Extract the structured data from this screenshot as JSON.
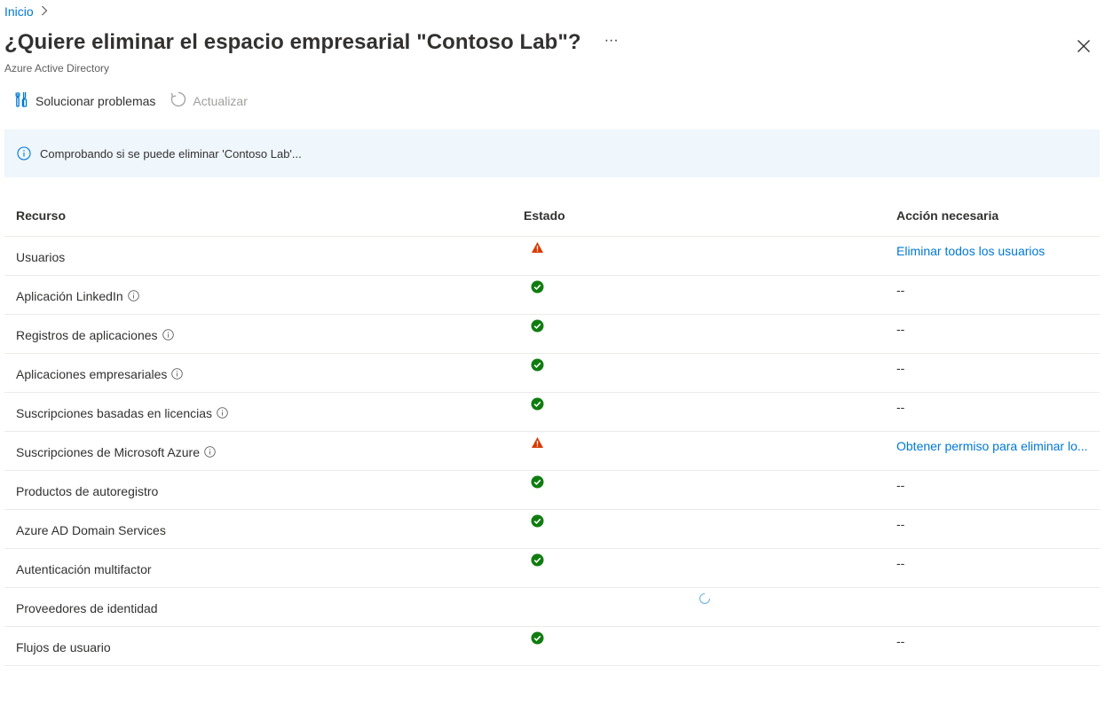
{
  "breadcrumb": {
    "home": "Inicio",
    "separator": ">"
  },
  "header": {
    "title": "¿Quiere eliminar el espacio empresarial \"Contoso Lab\"?",
    "more": "···",
    "subtitle": "Azure Active Directory"
  },
  "toolbar": {
    "troubleshoot": "Solucionar problemas",
    "refresh": "Actualizar"
  },
  "banner": {
    "text": "Comprobando si se puede eliminar 'Contoso Lab'..."
  },
  "table": {
    "headers": [
      "Recurso",
      "Estado",
      "Acción necesaria"
    ],
    "rows": [
      {
        "resource": "Usuarios",
        "info": false,
        "status": "warning",
        "action": "Eliminar todos los usuarios",
        "action_link": true
      },
      {
        "resource": "Aplicación LinkedIn",
        "info": true,
        "status": "success",
        "action": "--",
        "action_link": false
      },
      {
        "resource": "Registros de aplicaciones",
        "info": true,
        "status": "success",
        "action": "--",
        "action_link": false
      },
      {
        "resource": "Aplicaciones empresariales",
        "info": true,
        "status": "success",
        "action": "--",
        "action_link": false
      },
      {
        "resource": "Suscripciones basadas en licencias",
        "info": true,
        "status": "success",
        "action": "--",
        "action_link": false
      },
      {
        "resource": "Suscripciones de Microsoft Azure",
        "info": true,
        "status": "warning",
        "action": "Obtener permiso para eliminar lo...",
        "action_link": true
      },
      {
        "resource": "Productos de autoregistro",
        "info": false,
        "status": "success",
        "action": "--",
        "action_link": false
      },
      {
        "resource": "Azure AD Domain Services",
        "info": false,
        "status": "success",
        "action": "--",
        "action_link": false
      },
      {
        "resource": "Autenticación multifactor",
        "info": false,
        "status": "success",
        "action": "--",
        "action_link": false
      },
      {
        "resource": "Proveedores de identidad",
        "info": false,
        "status": "loading",
        "action": "",
        "action_link": false
      },
      {
        "resource": "Flujos de usuario",
        "info": false,
        "status": "success",
        "action": "--",
        "action_link": false
      }
    ]
  },
  "colors": {
    "accent": "#0078d4",
    "success": "#107c10",
    "warning": "#d83b01",
    "banner_bg": "#eff6fc"
  },
  "icons": {
    "close": "close-icon",
    "more": "more-icon",
    "troubleshoot": "troubleshoot-icon",
    "refresh": "refresh-icon",
    "info": "info-icon"
  }
}
